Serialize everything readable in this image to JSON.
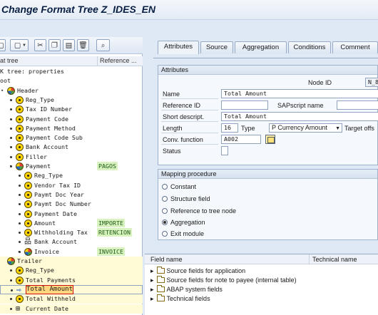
{
  "window": {
    "title": "Change Format Tree Z_IDES_EN"
  },
  "left_pane": {
    "toolbar": [
      {
        "name": "doc-button",
        "glyph": "▢"
      },
      {
        "name": "create-button",
        "glyph": "▢",
        "caret": "▼"
      },
      {
        "name": "cut-button",
        "glyph": "✂"
      },
      {
        "name": "copy-button",
        "glyph": "❐"
      },
      {
        "name": "paste-button",
        "glyph": "▤"
      },
      {
        "name": "delete-button",
        "glyph": "🗑"
      },
      {
        "name": "find-button",
        "glyph": "⌕"
      }
    ],
    "col_tree": "at tree",
    "col_ref": "Reference ...",
    "tree": [
      {
        "label": "tree: properties",
        "indent": 0,
        "icon": "none",
        "prefix": "K"
      },
      {
        "label": "oot",
        "indent": 0,
        "icon": "none"
      },
      {
        "label": "Header",
        "indent": 0,
        "icon": "multi",
        "expander": "open"
      },
      {
        "label": "Reg_Type",
        "indent": 1,
        "icon": "node",
        "ref": ""
      },
      {
        "label": "Tax ID Number",
        "indent": 1,
        "icon": "node"
      },
      {
        "label": "Payment Code",
        "indent": 1,
        "icon": "node"
      },
      {
        "label": "Payment Method",
        "indent": 1,
        "icon": "node"
      },
      {
        "label": "Payment Code Sub",
        "indent": 1,
        "icon": "node"
      },
      {
        "label": "Bank Account",
        "indent": 1,
        "icon": "node"
      },
      {
        "label": "Filler",
        "indent": 1,
        "icon": "node"
      },
      {
        "label": "Payment",
        "indent": 1,
        "icon": "multi",
        "ref": "PAGOS",
        "expander": "open"
      },
      {
        "label": "Reg_Type",
        "indent": 2,
        "icon": "node"
      },
      {
        "label": "Vendor Tax ID",
        "indent": 2,
        "icon": "node"
      },
      {
        "label": "Paymt Doc Year",
        "indent": 2,
        "icon": "node"
      },
      {
        "label": "Paymt Doc Number",
        "indent": 2,
        "icon": "node"
      },
      {
        "label": "Payment Date",
        "indent": 2,
        "icon": "node"
      },
      {
        "label": "Amount",
        "indent": 2,
        "icon": "node",
        "ref": "IMPORTE"
      },
      {
        "label": "Withholding Tax",
        "indent": 2,
        "icon": "node",
        "ref": "RETENCION"
      },
      {
        "label": "Bank Account",
        "indent": 2,
        "icon": "struct"
      },
      {
        "label": "Invoice",
        "indent": 2,
        "icon": "multi",
        "ref": "INVOICE",
        "expander": "closed"
      },
      {
        "label": "Trailer",
        "indent": 0,
        "icon": "multi",
        "segment": true
      },
      {
        "label": "Reg_Type",
        "indent": 1,
        "icon": "node",
        "segment": true
      },
      {
        "label": "Total Payments",
        "indent": 1,
        "icon": "node",
        "segment": true
      },
      {
        "label": "Total Amount",
        "indent": 1,
        "icon": "arrow",
        "segment": true,
        "selected": true
      },
      {
        "label": "Total Withheld",
        "indent": 1,
        "icon": "node",
        "segment": true
      },
      {
        "label": "Current Date",
        "indent": 1,
        "icon": "struct2",
        "segment": true
      }
    ]
  },
  "right_pane": {
    "tabs": [
      "Attributes",
      "Source",
      "Aggregation",
      "Conditions",
      "Comment"
    ],
    "active_tab": "Attributes",
    "attributes": {
      "group_title": "Attributes",
      "node_id_label": "Node ID",
      "node_id_value": "N_8",
      "name_label": "Name",
      "name_value": "Total Amount",
      "ref_id_label": "Reference ID",
      "ref_id_value": "",
      "sapscript_label": "SAPscript name",
      "sapscript_value": "",
      "short_descr_label": "Short descript.",
      "short_descr_value": "Total Amount",
      "length_label": "Length",
      "length_value": "16",
      "type_label": "Type",
      "type_value": "P Currency Amount",
      "target_offset_label": "Target offs",
      "conv_label": "Conv. function",
      "conv_value": "A002",
      "status_label": "Status",
      "status_value": ""
    },
    "mapping": {
      "group_title": "Mapping procedure",
      "options": [
        "Constant",
        "Structure field",
        "Reference to tree node",
        "Aggregation",
        "Exit module"
      ],
      "selected": "Aggregation"
    },
    "fields_table": {
      "col_name": "Field name",
      "col_tech": "Technical name",
      "rows": [
        "Source fields for application",
        "Source fields for note to payee (internal table)",
        "ABAP system fields",
        "Technical fields"
      ]
    }
  }
}
